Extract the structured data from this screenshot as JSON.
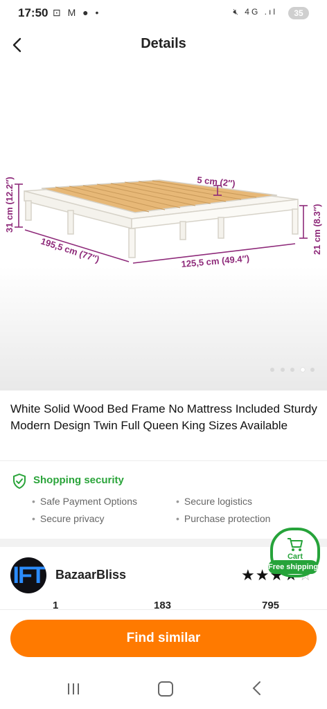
{
  "status_bar": {
    "time": "17:50",
    "battery": "35",
    "network": "4G"
  },
  "header": {
    "title": "Details"
  },
  "product_image": {
    "dimensions": {
      "height_left": "31 cm (12.2″)",
      "depth": "5 cm (2″)",
      "length": "195,5 cm (77″)",
      "width": "125,5 cm (49.4″)",
      "height_right": "21 cm (8.3″)"
    },
    "carousel": {
      "count": 5,
      "active_index": 3
    }
  },
  "product": {
    "title": "White Solid Wood Bed Frame No Mattress Included Sturdy Modern Design Twin Full Queen King Sizes Available"
  },
  "security": {
    "heading": "Shopping security",
    "items": [
      "Safe Payment Options",
      "Secure logistics",
      "Secure privacy",
      "Purchase protection"
    ]
  },
  "seller": {
    "avatar_text": "IFT",
    "name": "BazaarBliss",
    "rating_stars": "★★★★",
    "rating_half": "☆",
    "stats": [
      "1",
      "183",
      "795"
    ]
  },
  "cart_badge": {
    "label": "Cart",
    "shipping": "Free shipping"
  },
  "actions": {
    "find_similar": "Find similar"
  },
  "colors": {
    "accent": "#ff7a00",
    "security_green": "#2aa43a",
    "dimension_purple": "#8e2a7a"
  }
}
